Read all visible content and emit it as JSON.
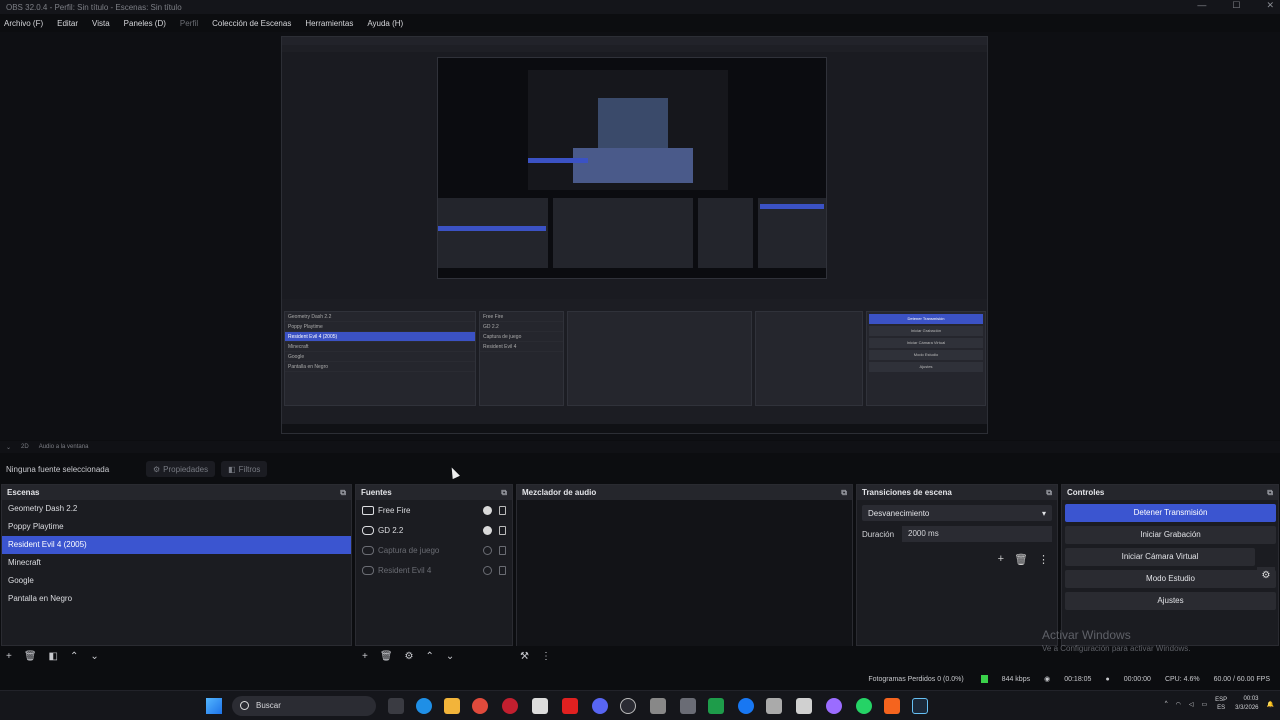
{
  "window": {
    "title": "OBS 32.0.4 - Perfil: Sin título - Escenas: Sin título"
  },
  "menu": [
    {
      "label": "Archivo (F)",
      "dim": false
    },
    {
      "label": "Editar",
      "dim": false
    },
    {
      "label": "Vista",
      "dim": false
    },
    {
      "label": "Paneles (D)",
      "dim": false
    },
    {
      "label": "Perfil",
      "dim": true
    },
    {
      "label": "Colección de Escenas",
      "dim": false
    },
    {
      "label": "Herramientas",
      "dim": false
    },
    {
      "label": "Ayuda (H)",
      "dim": false
    }
  ],
  "strip": {
    "items": [
      "2D",
      "Audio a la ventana"
    ]
  },
  "source_bar": {
    "status": "Ninguna fuente seleccionada",
    "properties": "Propiedades",
    "filters": "Filtros"
  },
  "scenes": {
    "title": "Escenas",
    "items": [
      {
        "label": "Geometry Dash 2.2",
        "selected": false
      },
      {
        "label": "Poppy Playtime",
        "selected": false
      },
      {
        "label": "Resident Evil 4 (2005)",
        "selected": true
      },
      {
        "label": "Minecraft",
        "selected": false
      },
      {
        "label": "Google",
        "selected": false
      },
      {
        "label": "Pantalla en Negro",
        "selected": false
      }
    ]
  },
  "sources": {
    "title": "Fuentes",
    "items": [
      {
        "label": "Free Fire",
        "dim": false,
        "icon": "monitor-icon"
      },
      {
        "label": "GD 2.2",
        "dim": false,
        "icon": "gamepad-icon"
      },
      {
        "label": "Captura de juego",
        "dim": true,
        "icon": "gamepad-icon"
      },
      {
        "label": "Resident Evil 4",
        "dim": true,
        "icon": "gamepad-icon"
      }
    ]
  },
  "audio_mixer": {
    "title": "Mezclador de audio"
  },
  "transitions": {
    "title": "Transiciones de escena",
    "selected": "Desvanecimiento",
    "duration_label": "Duración",
    "duration_value": "2000 ms"
  },
  "controls": {
    "title": "Controles",
    "stop_stream": "Detener Transmisión",
    "start_recording": "Iniciar Grabación",
    "start_virtual_cam": "Iniciar Cámara Virtual",
    "studio_mode": "Modo Estudio",
    "settings": "Ajustes"
  },
  "watermark": {
    "line1": "Activar Windows",
    "line2": "Ve a Configuración para activar Windows."
  },
  "status": {
    "dropped_frames": "Fotogramas Perdidos 0 (0.0%)",
    "bitrate": "844 kbps",
    "stream_time": "00:18:05",
    "rec_time": "00:00:00",
    "cpu": "CPU: 4.6%",
    "fps": "60.00 / 60.00 FPS"
  },
  "taskbar": {
    "search_placeholder": "Buscar",
    "lang": "ESP",
    "lang_sub": "ES",
    "time": "00:03",
    "date": "3/3/2026"
  },
  "nested_preview": {
    "scenes": [
      "Geometry Dash 2.2",
      "Poppy Playtime",
      "Resident Evil 4 (2005)",
      "Minecraft",
      "Google",
      "Pantalla en Negro"
    ],
    "sources": [
      "Free Fire",
      "GD 2.2",
      "Captura de juego",
      "Resident Evil 4"
    ],
    "controls": [
      "Detener Transmisión",
      "Iniciar Grabación",
      "Iniciar Cámara Virtual",
      "Modo Estudio",
      "Ajustes"
    ]
  },
  "colors": {
    "accent": "#3b55d0",
    "panel": "#1b1c21",
    "header": "#25262c",
    "background": "#0e0f13"
  }
}
